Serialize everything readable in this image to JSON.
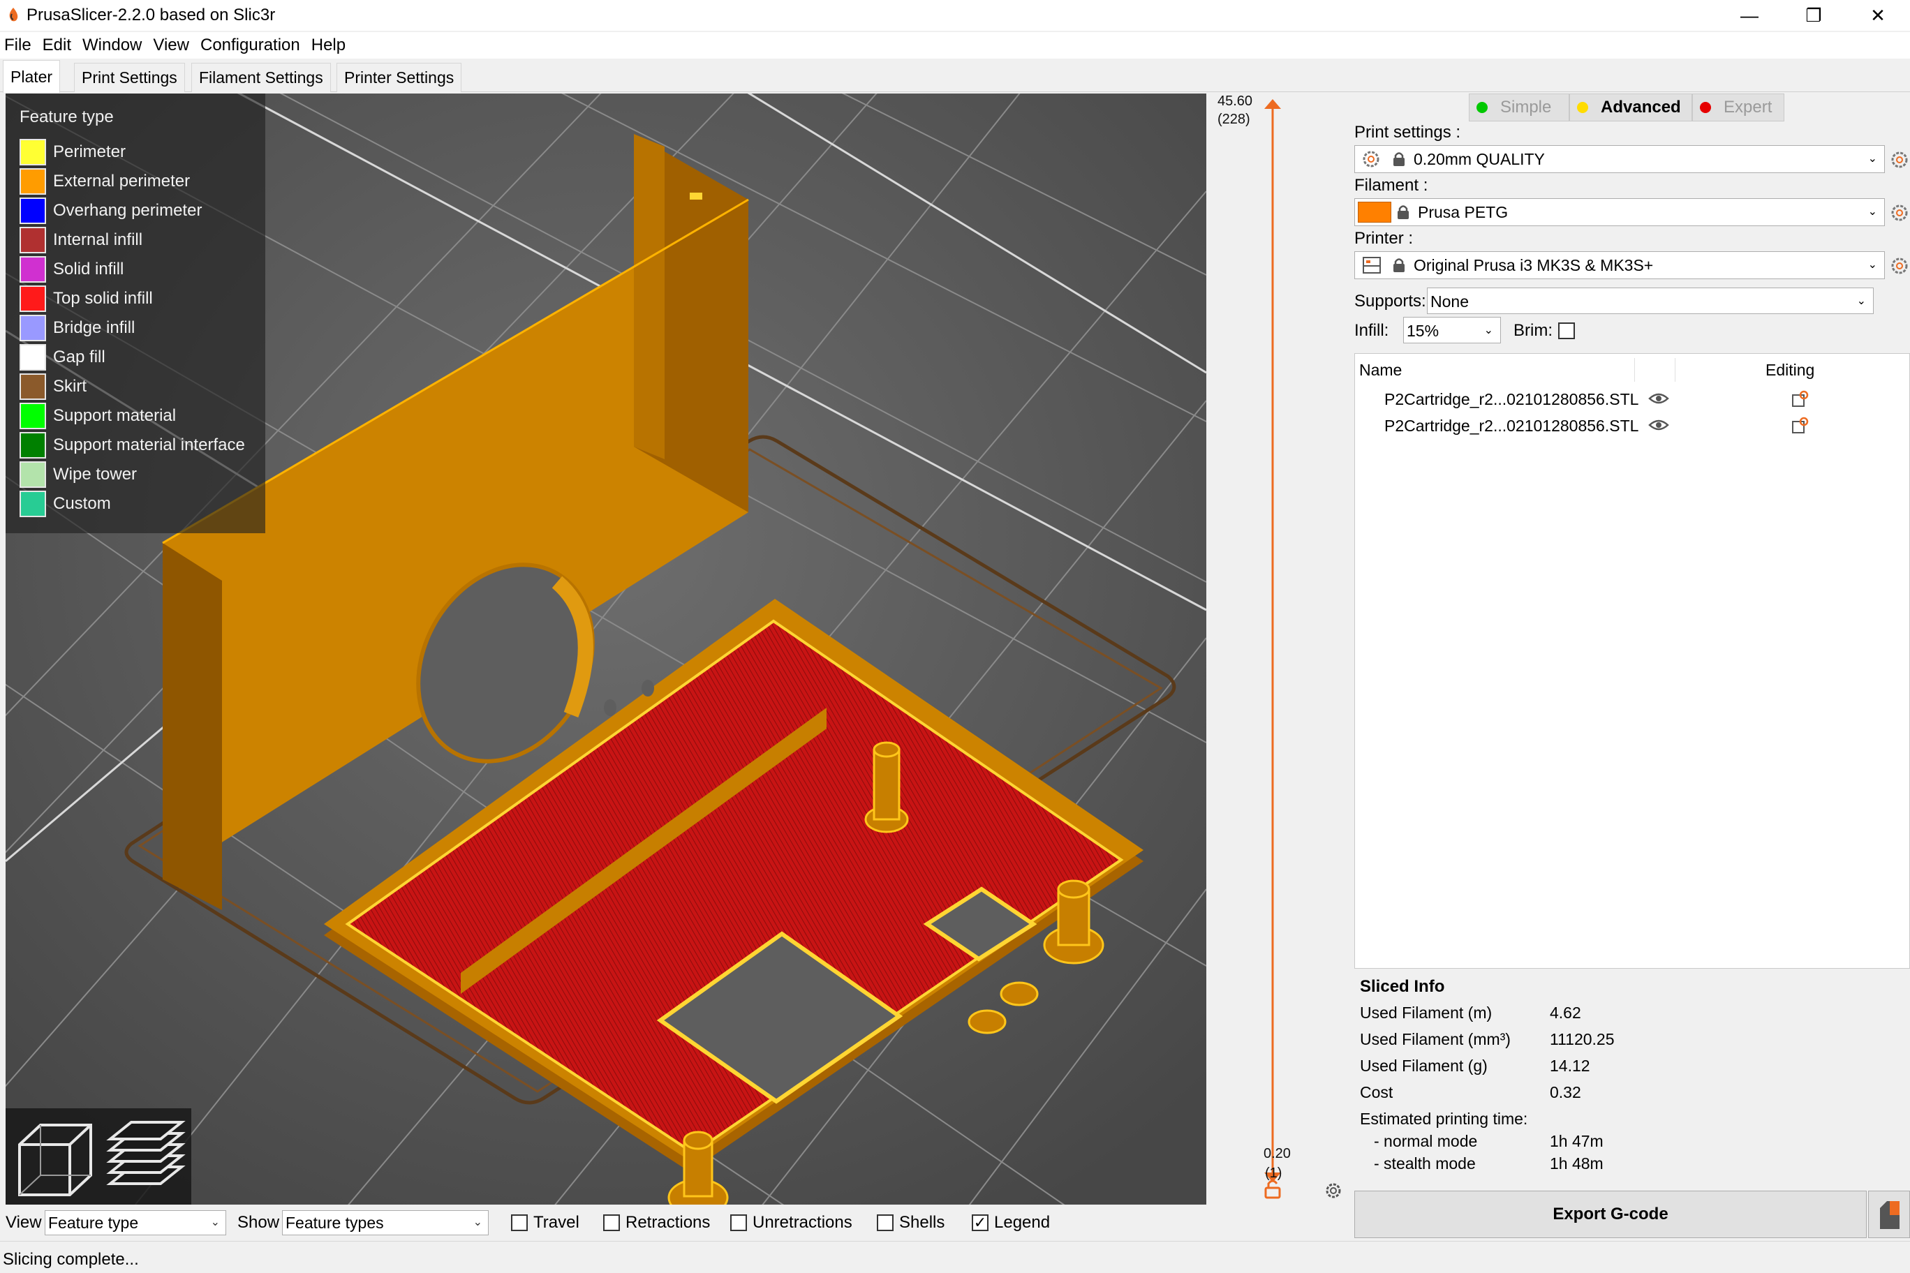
{
  "window": {
    "title": "PrusaSlicer-2.2.0 based on Slic3r"
  },
  "window_controls": {
    "minimize": "—",
    "maximize": "❐",
    "close": "✕"
  },
  "menu": [
    "File",
    "Edit",
    "Window",
    "View",
    "Configuration",
    "Help"
  ],
  "tabs": [
    "Plater",
    "Print Settings",
    "Filament Settings",
    "Printer Settings"
  ],
  "legend": {
    "title": "Feature type",
    "items": [
      {
        "label": "Perimeter",
        "color": "#ffff33"
      },
      {
        "label": "External perimeter",
        "color": "#ff9c00"
      },
      {
        "label": "Overhang perimeter",
        "color": "#0000ff"
      },
      {
        "label": "Internal infill",
        "color": "#b03030"
      },
      {
        "label": "Solid infill",
        "color": "#d030d0"
      },
      {
        "label": "Top solid infill",
        "color": "#ff1a1a"
      },
      {
        "label": "Bridge infill",
        "color": "#9999ff"
      },
      {
        "label": "Gap fill",
        "color": "#ffffff"
      },
      {
        "label": "Skirt",
        "color": "#8b5a2b"
      },
      {
        "label": "Support material",
        "color": "#00ff00"
      },
      {
        "label": "Support material interface",
        "color": "#008000"
      },
      {
        "label": "Wipe tower",
        "color": "#b3e3ab"
      },
      {
        "label": "Custom",
        "color": "#28cc94"
      }
    ]
  },
  "layer_slider": {
    "top_value": "45.60",
    "top_layer": "(228)",
    "bottom_value": "0.20",
    "bottom_layer": "(1)",
    "accent": "#ed6b21"
  },
  "bottom_bar": {
    "view_label": "View",
    "view_value": "Feature type",
    "show_label": "Show",
    "show_value": "Feature types",
    "checkboxes": [
      {
        "label": "Travel",
        "checked": false
      },
      {
        "label": "Retractions",
        "checked": false
      },
      {
        "label": "Unretractions",
        "checked": false
      },
      {
        "label": "Shells",
        "checked": false
      },
      {
        "label": "Legend",
        "checked": true
      }
    ]
  },
  "status": "Slicing complete...",
  "sidebar": {
    "modes": [
      {
        "label": "Simple",
        "color": "#00c800",
        "active": false
      },
      {
        "label": "Advanced",
        "color": "#ffdc00",
        "active": true
      },
      {
        "label": "Expert",
        "color": "#e60000",
        "active": false
      }
    ],
    "print_settings_label": "Print settings :",
    "print_settings_value": "0.20mm QUALITY",
    "filament_label": "Filament :",
    "filament_value": "Prusa PETG",
    "filament_color": "#ff8000",
    "printer_label": "Printer :",
    "printer_value": "Original Prusa i3 MK3S & MK3S+",
    "supports_label": "Supports:",
    "supports_value": "None",
    "infill_label": "Infill:",
    "infill_value": "15%",
    "brim_label": "Brim:",
    "brim_checked": false,
    "object_list": {
      "col_name": "Name",
      "col_editing": "Editing",
      "objects": [
        {
          "name": "P2Cartridge_r2...02101280856.STL"
        },
        {
          "name": "P2Cartridge_r2...02101280856.STL"
        }
      ]
    },
    "sliced_info": {
      "title": "Sliced Info",
      "rows": [
        {
          "label": "Used Filament (m)",
          "value": "4.62"
        },
        {
          "label": "Used Filament (mm³)",
          "value": "11120.25"
        },
        {
          "label": "Used Filament (g)",
          "value": "14.12"
        },
        {
          "label": "Cost",
          "value": "0.32"
        }
      ],
      "time_label": "Estimated printing time:",
      "time_rows": [
        {
          "label": "- normal mode",
          "value": "1h 47m"
        },
        {
          "label": "- stealth mode",
          "value": "1h 48m"
        }
      ]
    },
    "export_label": "Export G-code"
  }
}
